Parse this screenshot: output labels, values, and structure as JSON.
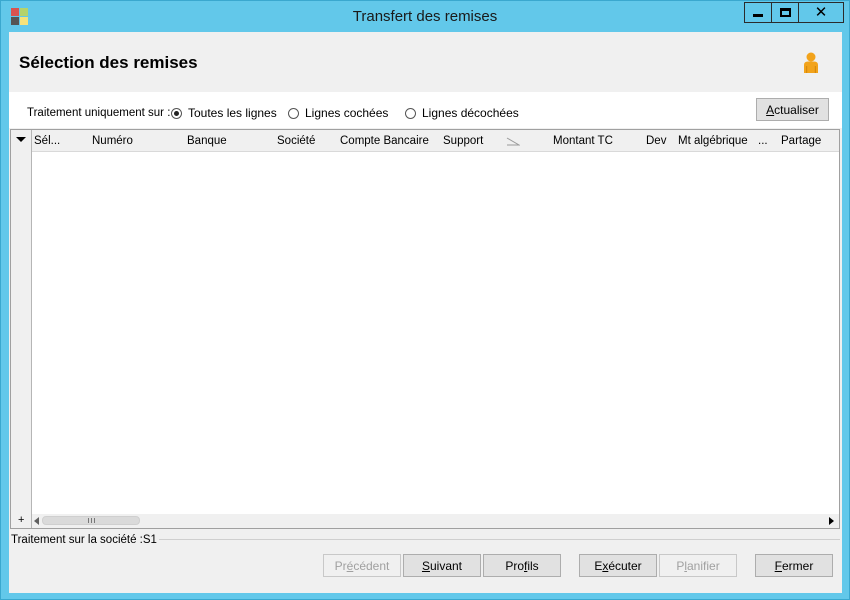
{
  "window": {
    "title": "Transfert des remises",
    "close_glyph": "✕"
  },
  "header": {
    "title": "Sélection des remises"
  },
  "options": {
    "label": "Traitement uniquement sur :",
    "radios": [
      {
        "label": "Toutes les lignes",
        "selected": true
      },
      {
        "label": "Lignes cochées",
        "selected": false
      },
      {
        "label": "Lignes décochées",
        "selected": false
      }
    ],
    "refresh": {
      "u": "A",
      "rest": "ctualiser"
    }
  },
  "grid": {
    "columns": [
      "Sél...",
      "Numéro",
      "Banque",
      "Société",
      "Compte Bancaire",
      "Support",
      "Montant TC",
      "Dev",
      "Mt algébrique",
      "...",
      "Partage"
    ],
    "add_glyph": "+"
  },
  "status": {
    "text": "Traitement sur la société :S1"
  },
  "buttons": {
    "prev": {
      "pre": "Pr",
      "u": "é",
      "post": "cédent"
    },
    "next": {
      "pre": "",
      "u": "S",
      "post": "uivant"
    },
    "profiles": {
      "pre": "Pro",
      "u": "f",
      "post": "ils"
    },
    "execute": {
      "pre": "E",
      "u": "x",
      "post": "écuter"
    },
    "plan": {
      "pre": "P",
      "u": "l",
      "post": "anifier"
    },
    "close": {
      "pre": "",
      "u": "F",
      "post": "ermer"
    }
  },
  "colors": {
    "frame": "#62c8ea",
    "client": "#f0f0f0",
    "user_icon": "#f2a31b"
  },
  "icons": {
    "app": "app-tiles-icon",
    "user": "user-icon",
    "sort": "sort-indicator-icon",
    "filter": "filter-dropdown-icon"
  }
}
